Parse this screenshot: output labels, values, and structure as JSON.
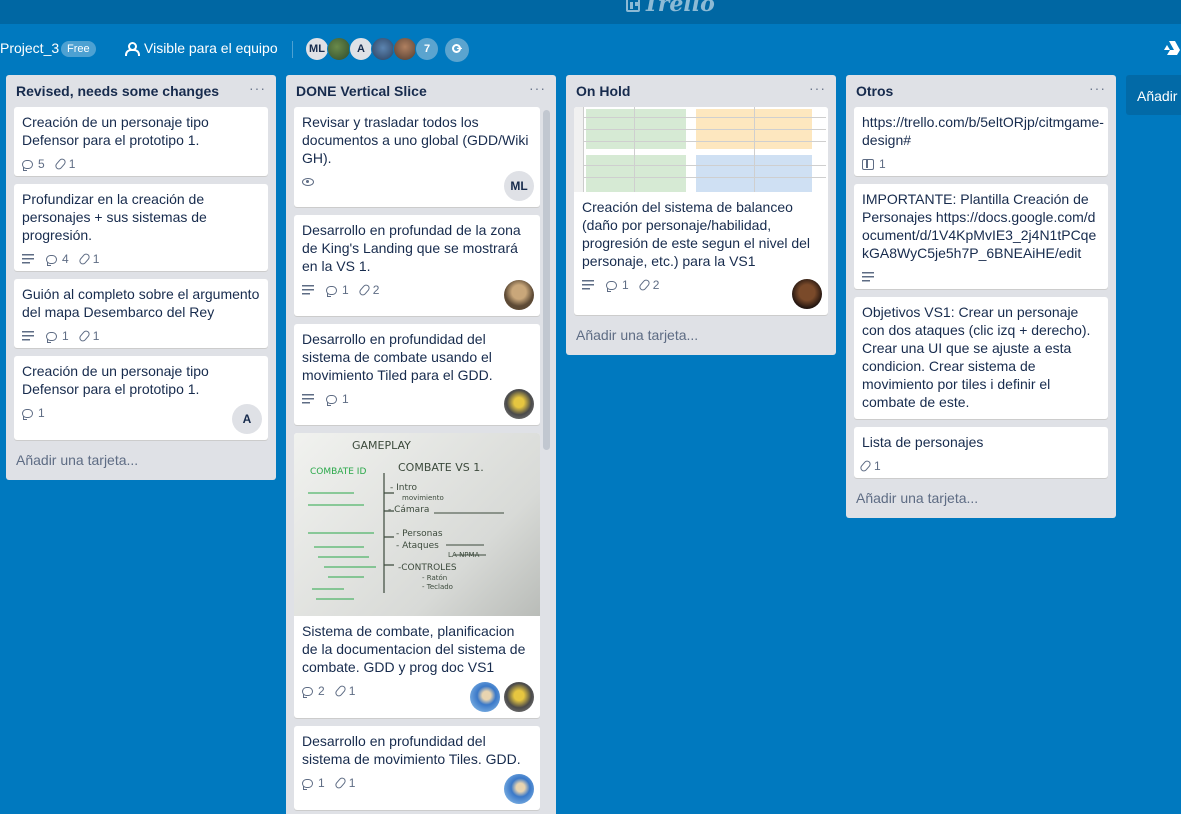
{
  "app": {
    "logo_text": "Trello"
  },
  "board": {
    "name": "Project_3",
    "plan_badge": "Free",
    "visibility": "Visible para el equipo",
    "members": [
      "ML",
      "A"
    ],
    "member_count_more": "7"
  },
  "lists": [
    {
      "title": "Revised, needs some changes",
      "menu": "···",
      "add_card": "Añadir una tarjeta...",
      "cards": [
        {
          "text": "Creación de un personaje tipo Defensor para el prototipo 1.",
          "comments": "5",
          "attachments": "1"
        },
        {
          "text": "Profundizar en la creación de personajes + sus sistemas de progresión.",
          "comments": "4",
          "attachments": "1"
        },
        {
          "text": "Guión al completo sobre el argumento del mapa Desembarco del Rey",
          "comments": "1",
          "attachments": "1"
        },
        {
          "text": "Creación de un personaje tipo Defensor para el prototipo 1.",
          "comments": "1",
          "member": "A"
        }
      ]
    },
    {
      "title": "DONE Vertical Slice",
      "menu": "···",
      "cards": [
        {
          "text": "Revisar y trasladar todos los documentos a uno global (GDD/Wiki GH).",
          "member": "ML"
        },
        {
          "text": "Desarrollo en profundad de la zona de King's Landing que se mostrará en la VS 1.",
          "comments": "1",
          "attachments": "2"
        },
        {
          "text": "Desarrollo en profundidad del sistema de combate usando el movimiento Tiled para el GDD.",
          "comments": "1"
        },
        {
          "text": "Sistema de combate, planificacion de la documentacion del sistema de combate. GDD y prog doc VS1",
          "comments": "2",
          "attachments": "1",
          "whiteboard": [
            "GAMEPLAY",
            "COMBATE VS 1.",
            "- Intro",
            "movimiento",
            "- Cámara",
            "- Personas",
            "- Ataques",
            "-CONTROLES",
            "- Ratón",
            "- Teclado",
            "COMBATE ID",
            "LA NPMA"
          ]
        },
        {
          "text": "Desarrollo en profundidad del sistema de movimiento Tiles. GDD.",
          "comments": "1",
          "attachments": "1"
        }
      ]
    },
    {
      "title": "On Hold",
      "menu": "···",
      "add_card": "Añadir una tarjeta...",
      "cards": [
        {
          "text": "Creación del sistema de balanceo (daño por personaje/habilidad, progresión de este segun el nivel del personaje, etc.) para la VS1",
          "comments": "1",
          "attachments": "2"
        }
      ]
    },
    {
      "title": "Otros",
      "menu": "···",
      "add_card": "Añadir una tarjeta...",
      "cards": [
        {
          "text": "https://trello.com/b/5eltORjp/citmgame-design#",
          "boards": "1"
        },
        {
          "text": "IMPORTANTE: Plantilla Creación de Personajes https://docs.google.com/document/d/1V4KpMvIE3_2j4N1tPCqekGA8WyC5je5h7P_6BNEAiHE/edit"
        },
        {
          "text": "Objetivos VS1: Crear un personaje con dos ataques (clic izq + derecho). Crear una UI que se ajuste a esta condicion. Crear sistema de movimiento por tiles i definir el combate de este."
        },
        {
          "text": "Lista de personajes",
          "attachments": "1"
        }
      ]
    }
  ],
  "add_list": "Añadir",
  "colors": {
    "board_bg": "#0079bf",
    "list_bg": "#dfe1e6",
    "topbar": "#0067a3"
  }
}
